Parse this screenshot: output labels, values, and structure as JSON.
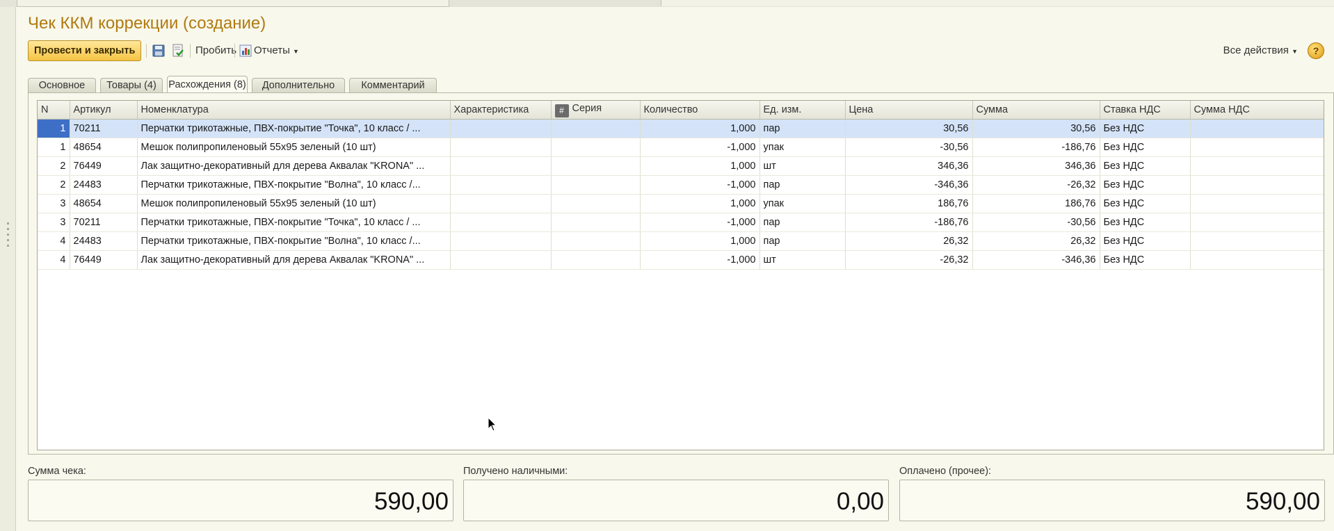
{
  "window": {
    "title": "Чек ККМ коррекции (создание)"
  },
  "toolbar": {
    "post_and_close_label": "Провести и закрыть",
    "punch_label": "Пробить",
    "reports_label": "Отчеты",
    "all_actions_label": "Все действия",
    "help_label": "?"
  },
  "tabs": [
    {
      "label": "Основное"
    },
    {
      "label": "Товары (4)"
    },
    {
      "label": "Расхождения (8)",
      "active": true
    },
    {
      "label": "Дополнительно"
    },
    {
      "label": "Комментарий"
    }
  ],
  "table": {
    "columns": [
      "N",
      "Артикул",
      "Номенклатура",
      "Характеристика",
      "Серия",
      "Количество",
      "Ед. изм.",
      "Цена",
      "Сумма",
      "Ставка НДС",
      "Сумма НДС"
    ],
    "rows": [
      {
        "n": "1",
        "article": "70211",
        "item": "Перчатки трикотажные, ПВХ-покрытие \"Точка\", 10 класс / ...",
        "char": "",
        "series": "",
        "qty": "1,000",
        "unit": "пар",
        "price": "30,56",
        "sum": "30,56",
        "vat_rate": "Без НДС",
        "vat_sum": ""
      },
      {
        "n": "1",
        "article": "48654",
        "item": "Мешок полипропиленовый 55х95 зеленый (10 шт)",
        "char": "",
        "series": "",
        "qty": "-1,000",
        "unit": "упак",
        "price": "-30,56",
        "sum": "-186,76",
        "vat_rate": "Без НДС",
        "vat_sum": ""
      },
      {
        "n": "2",
        "article": "76449",
        "item": "Лак защитно-декоративный для дерева Аквалак \"KRONA\" ...",
        "char": "",
        "series": "",
        "qty": "1,000",
        "unit": "шт",
        "price": "346,36",
        "sum": "346,36",
        "vat_rate": "Без НДС",
        "vat_sum": ""
      },
      {
        "n": "2",
        "article": "24483",
        "item": "Перчатки трикотажные, ПВХ-покрытие \"Волна\", 10 класс /...",
        "char": "",
        "series": "",
        "qty": "-1,000",
        "unit": "пар",
        "price": "-346,36",
        "sum": "-26,32",
        "vat_rate": "Без НДС",
        "vat_sum": ""
      },
      {
        "n": "3",
        "article": "48654",
        "item": "Мешок полипропиленовый 55х95 зеленый (10 шт)",
        "char": "",
        "series": "",
        "qty": "1,000",
        "unit": "упак",
        "price": "186,76",
        "sum": "186,76",
        "vat_rate": "Без НДС",
        "vat_sum": ""
      },
      {
        "n": "3",
        "article": "70211",
        "item": "Перчатки трикотажные, ПВХ-покрытие \"Точка\", 10 класс / ...",
        "char": "",
        "series": "",
        "qty": "-1,000",
        "unit": "пар",
        "price": "-186,76",
        "sum": "-30,56",
        "vat_rate": "Без НДС",
        "vat_sum": ""
      },
      {
        "n": "4",
        "article": "24483",
        "item": "Перчатки трикотажные, ПВХ-покрытие \"Волна\", 10 класс /...",
        "char": "",
        "series": "",
        "qty": "1,000",
        "unit": "пар",
        "price": "26,32",
        "sum": "26,32",
        "vat_rate": "Без НДС",
        "vat_sum": ""
      },
      {
        "n": "4",
        "article": "76449",
        "item": "Лак защитно-декоративный для дерева Аквалак \"KRONA\" ...",
        "char": "",
        "series": "",
        "qty": "-1,000",
        "unit": "шт",
        "price": "-26,32",
        "sum": "-346,36",
        "vat_rate": "Без НДС",
        "vat_sum": ""
      }
    ]
  },
  "footer": {
    "receipt_sum_label": "Сумма чека:",
    "receipt_sum_value": "590,00",
    "cash_received_label": "Получено наличными:",
    "cash_received_value": "0,00",
    "paid_other_label": "Оплачено (прочее):",
    "paid_other_value": "590,00"
  },
  "colors": {
    "title": "#b07a10",
    "primary_button": "#f5c444",
    "selection": "#3e6fc6"
  },
  "icons": [
    "save-icon",
    "post-icon",
    "reports-icon",
    "help-icon",
    "pointer-cursor-icon"
  ]
}
